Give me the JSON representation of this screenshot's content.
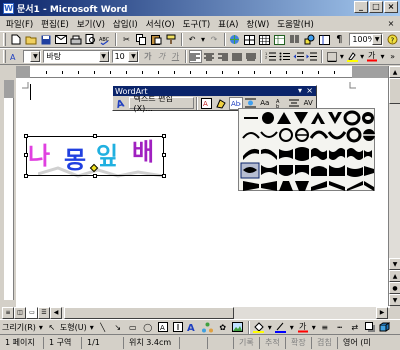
{
  "window": {
    "title": "문서1 - Microsoft Word",
    "app_icon": "W"
  },
  "window_buttons": {
    "minimize": "_",
    "maximize": "□",
    "close": "×"
  },
  "menubar": {
    "items": [
      "파일(F)",
      "편집(E)",
      "보기(V)",
      "삽입(I)",
      "서식(O)",
      "도구(T)",
      "표(A)",
      "창(W)",
      "도움말(H)"
    ],
    "doc_close": "×"
  },
  "toolbar1": {
    "zoom": "100%"
  },
  "toolbar2": {
    "style": "",
    "font": "바탕",
    "size": "10"
  },
  "wordart": {
    "chars": [
      {
        "ch": "나",
        "color": "#e040e0"
      },
      {
        "ch": "몽",
        "color": "#2040e0"
      },
      {
        "ch": "잎",
        "color": "#20b0e0"
      },
      {
        "ch": "배",
        "color": "#a020c0"
      }
    ]
  },
  "wordart_toolbar": {
    "title": "WordArt",
    "edit_text": "텍스트 편집(X)..."
  },
  "statusbar": {
    "page": "1 페이지",
    "section": "1 구역",
    "pages": "1/1",
    "position": "위치 3.4cm",
    "line": "",
    "col": "",
    "rec": "기록",
    "trk": "추적",
    "ext": "확장",
    "ovr": "겹침",
    "lang": "영어 (미"
  },
  "drawbar": {
    "draw_menu": "그리기(R)",
    "autoshape_menu": "도형(U)"
  },
  "colors": {
    "titlebar_start": "#0a246a",
    "titlebar_end": "#a6caf0",
    "chrome": "#d4d0c8",
    "gallery_selected": "#b6bdd2"
  }
}
